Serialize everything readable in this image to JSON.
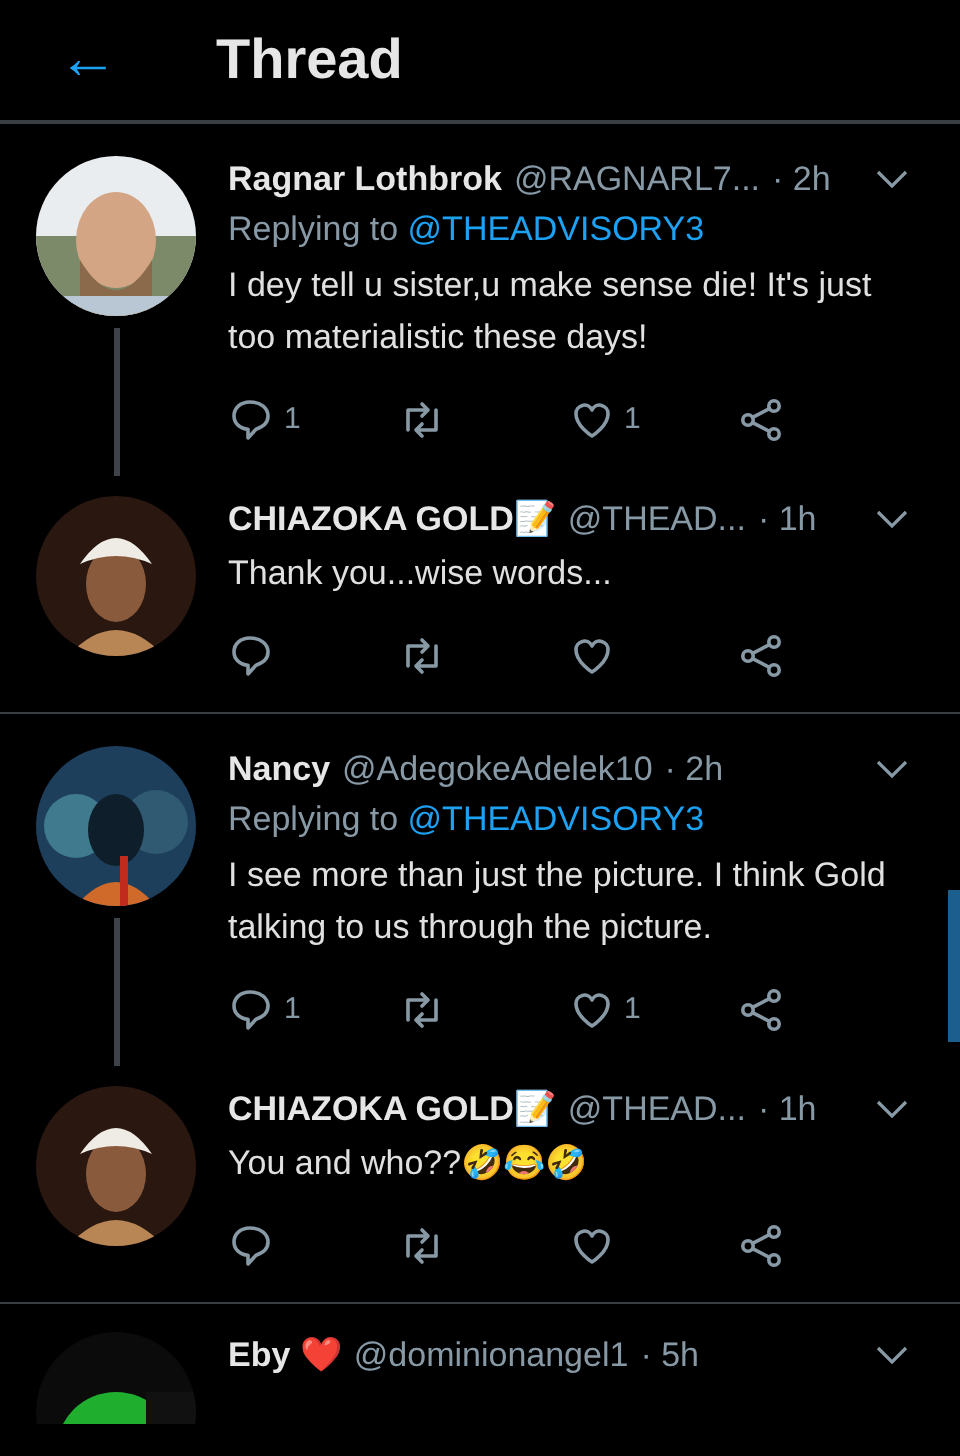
{
  "header": {
    "back": "←",
    "title": "Thread"
  },
  "tweets": [
    {
      "name": "Ragnar Lothbrok",
      "handle": "@RAGNARL7...",
      "time": "· 2h",
      "replying_to": {
        "label": "Replying to",
        "handle": "@THEADVISORY3"
      },
      "text": "I dey tell u sister,u make sense die! It's just too materialistic these days!",
      "replies": "1",
      "likes": "1",
      "thread_continues": true,
      "divider_below": false
    },
    {
      "name": "CHIAZOKA GOLD📝",
      "handle": "@THEAD...",
      "time": "· 1h",
      "text": "Thank you...wise words...",
      "thread_continues": false,
      "divider_below": true
    },
    {
      "name": "Nancy",
      "handle": "@AdegokeAdelek10",
      "time": "· 2h",
      "replying_to": {
        "label": "Replying to",
        "handle": "@THEADVISORY3"
      },
      "text": "I see more than just the picture. I think Gold talking to us through the picture.",
      "replies": "1",
      "likes": "1",
      "thread_continues": true,
      "divider_below": false
    },
    {
      "name": "CHIAZOKA GOLD📝",
      "handle": "@THEAD...",
      "time": "· 1h",
      "text": "You and who??🤣😂🤣",
      "thread_continues": false,
      "divider_below": true
    }
  ],
  "next_tweet": {
    "name": "Eby ❤️",
    "handle": "@dominionangel1",
    "time": "· 5h"
  }
}
